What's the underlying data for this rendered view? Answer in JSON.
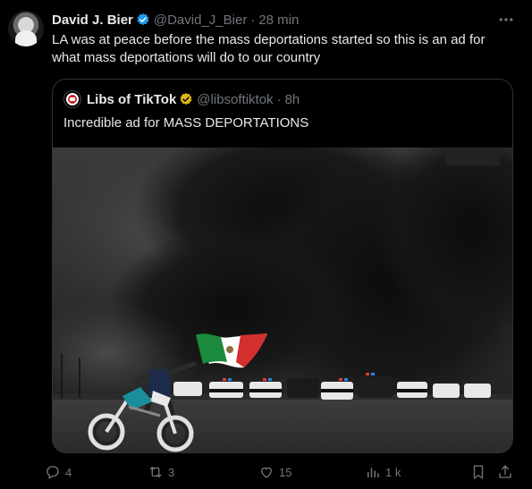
{
  "tweet": {
    "author": {
      "name": "David J. Bier",
      "handle": "@David_J_Bier",
      "time": "28 min"
    },
    "text": "LA was at peace before the mass deportations started so this is an ad for what mass deportations will do to our country",
    "quote": {
      "author": {
        "name": "Libs of TikTok",
        "handle": "@libsoftiktok",
        "time": "8h"
      },
      "text": "Incredible ad for MASS DEPORTATIONS"
    },
    "actions": {
      "replies": "4",
      "reposts": "3",
      "likes": "15",
      "views": "1 k"
    },
    "separator": "·"
  },
  "colors": {
    "verified_blue": "#1d9bf0",
    "verified_gold": "#e2b719",
    "muted": "#71767b",
    "text": "#e7e9ea",
    "border": "#2f3336"
  },
  "icons": [
    "verified-badge-icon",
    "more-icon",
    "reply-icon",
    "repost-icon",
    "like-icon",
    "views-icon",
    "bookmark-icon",
    "share-icon"
  ]
}
